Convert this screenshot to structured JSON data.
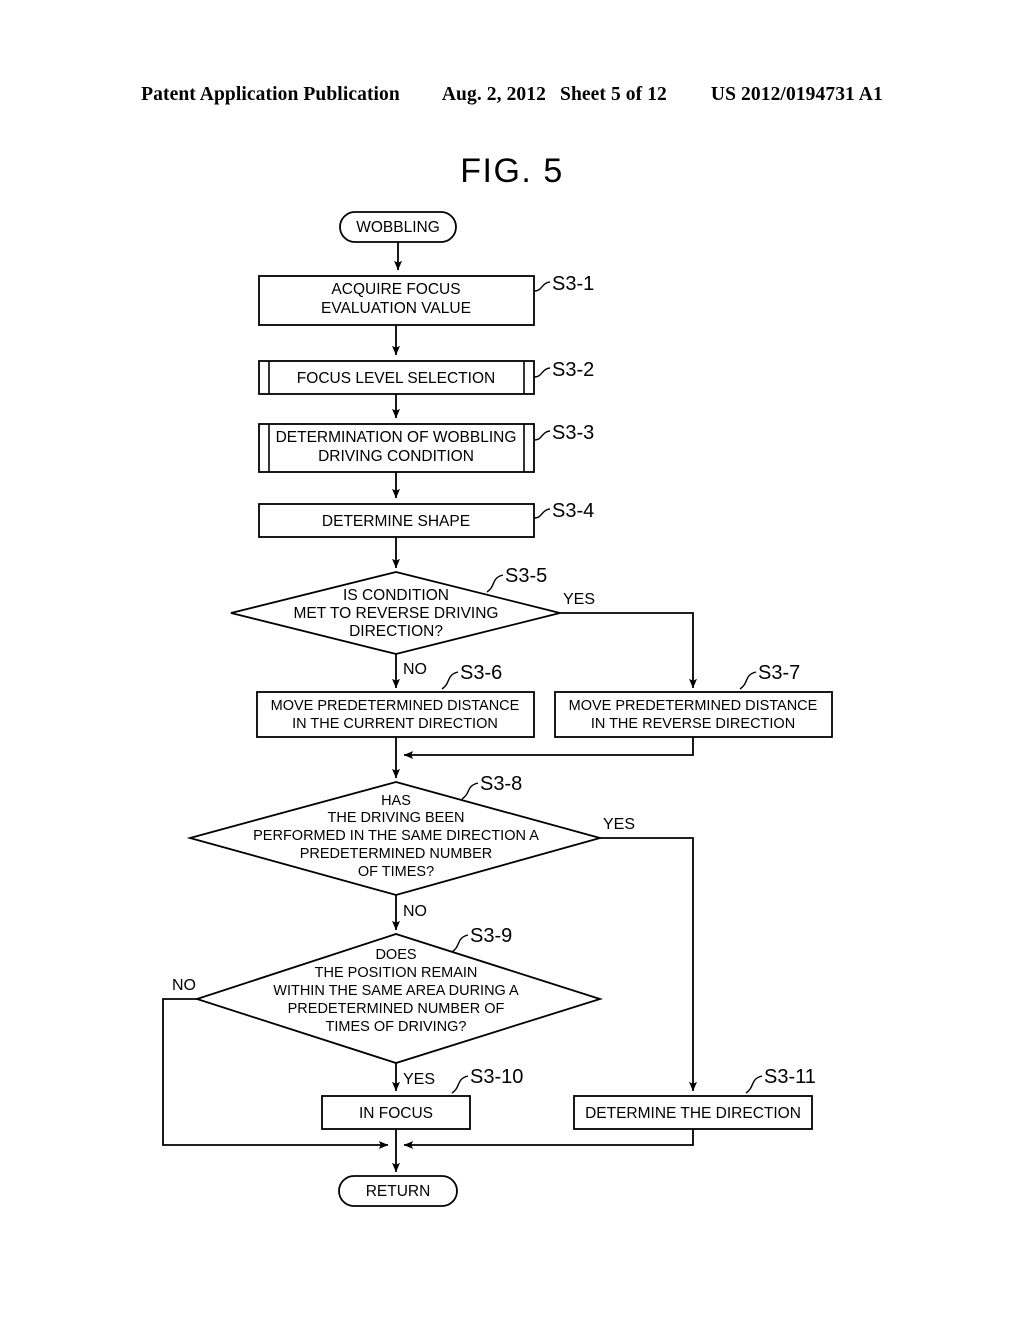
{
  "header": {
    "publication": "Patent Application Publication",
    "date": "Aug. 2, 2012",
    "sheet": "Sheet 5 of 12",
    "number": "US 2012/0194731 A1"
  },
  "figure": {
    "title": "FIG. 5"
  },
  "flowchart": {
    "nodes": {
      "start": {
        "label": "WOBBLING",
        "shape": "terminator"
      },
      "s3_1": {
        "step": "S3-1",
        "shape": "process",
        "lines": [
          "ACQUIRE FOCUS",
          "EVALUATION VALUE"
        ]
      },
      "s3_2": {
        "step": "S3-2",
        "shape": "subroutine",
        "lines": [
          "FOCUS LEVEL SELECTION"
        ]
      },
      "s3_3": {
        "step": "S3-3",
        "shape": "subroutine",
        "lines": [
          "DETERMINATION OF WOBBLING",
          "DRIVING CONDITION"
        ]
      },
      "s3_4": {
        "step": "S3-4",
        "shape": "process",
        "lines": [
          "DETERMINE SHAPE"
        ]
      },
      "s3_5": {
        "step": "S3-5",
        "shape": "decision",
        "lines": [
          "IS CONDITION",
          "MET TO REVERSE DRIVING",
          "DIRECTION?"
        ]
      },
      "s3_6": {
        "step": "S3-6",
        "shape": "process",
        "lines": [
          "MOVE PREDETERMINED DISTANCE",
          "IN THE CURRENT DIRECTION"
        ]
      },
      "s3_7": {
        "step": "S3-7",
        "shape": "process",
        "lines": [
          "MOVE PREDETERMINED DISTANCE",
          "IN THE REVERSE DIRECTION"
        ]
      },
      "s3_8": {
        "step": "S3-8",
        "shape": "decision",
        "lines": [
          "HAS",
          "THE DRIVING BEEN",
          "PERFORMED IN THE SAME DIRECTION A",
          "PREDETERMINED NUMBER",
          "OF TIMES?"
        ]
      },
      "s3_9": {
        "step": "S3-9",
        "shape": "decision",
        "lines": [
          "DOES",
          "THE POSITION REMAIN",
          "WITHIN THE SAME AREA DURING A",
          "PREDETERMINED NUMBER OF",
          "TIMES OF DRIVING?"
        ]
      },
      "s3_10": {
        "step": "S3-10",
        "shape": "process",
        "lines": [
          "IN FOCUS"
        ]
      },
      "s3_11": {
        "step": "S3-11",
        "shape": "process",
        "lines": [
          "DETERMINE THE DIRECTION"
        ]
      },
      "end": {
        "label": "RETURN",
        "shape": "terminator"
      }
    },
    "branches": {
      "s3_5_yes": "YES",
      "s3_5_no": "NO",
      "s3_8_yes": "YES",
      "s3_8_no": "NO",
      "s3_9_yes": "YES",
      "s3_9_no": "NO"
    },
    "colors": {
      "line": "#000000",
      "fill": "#ffffff",
      "text": "#000000"
    }
  }
}
